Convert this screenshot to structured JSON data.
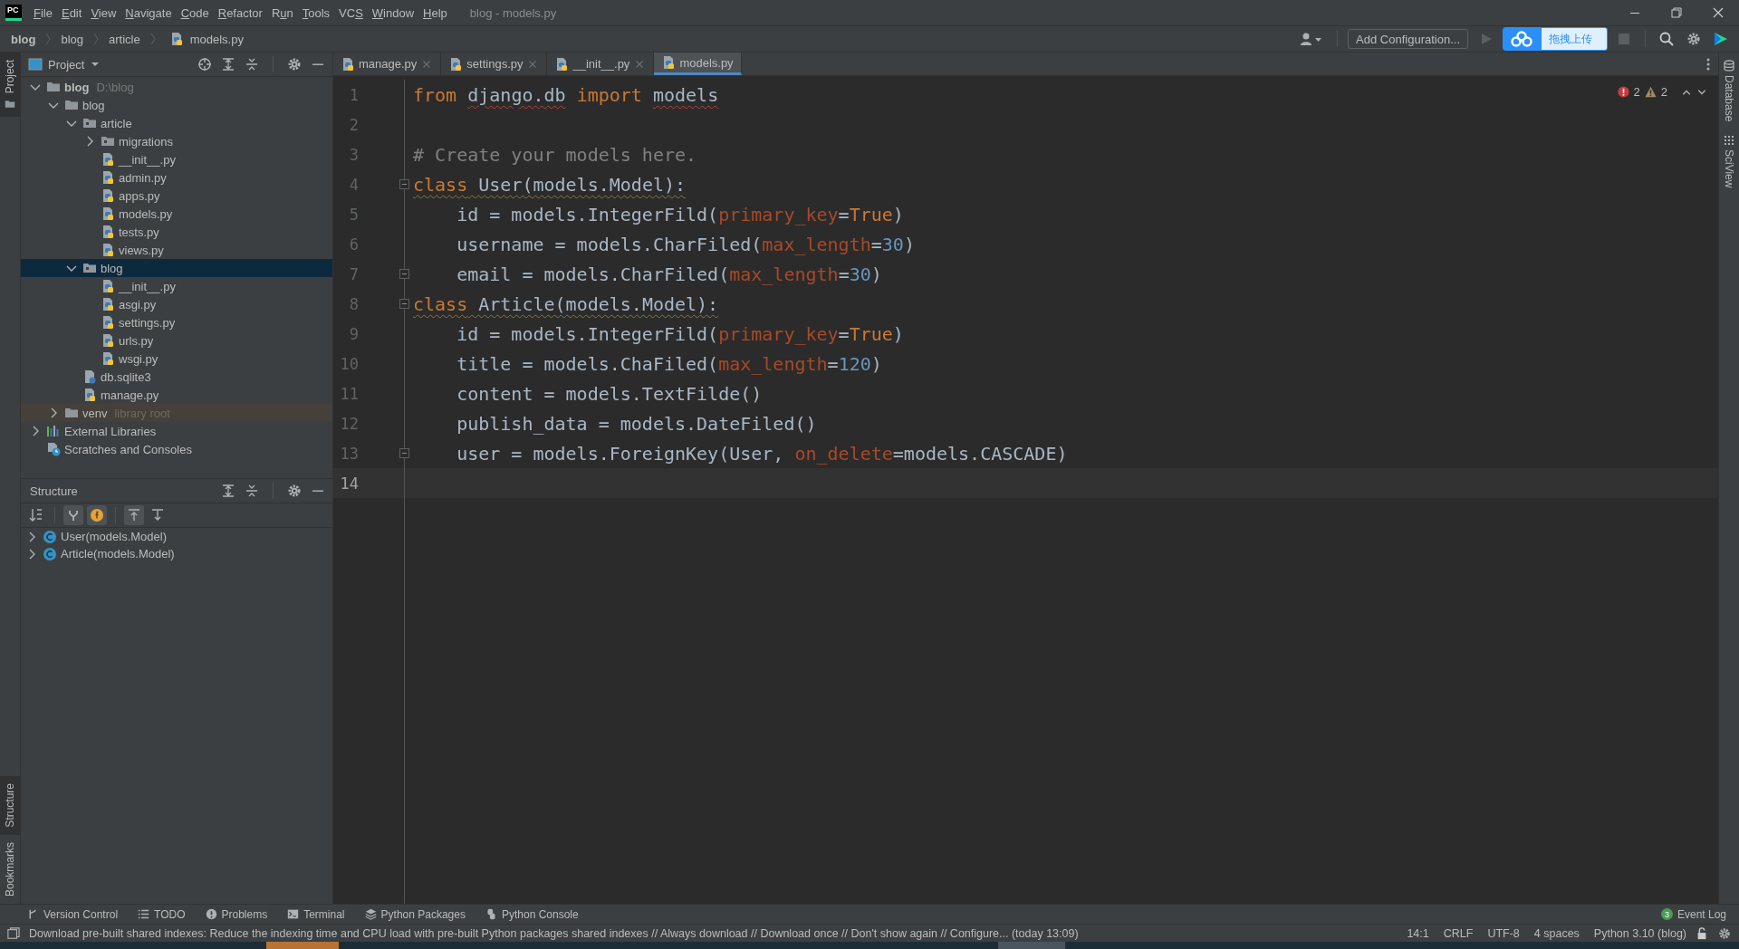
{
  "window": {
    "logo": "PC",
    "title": "blog - models.py",
    "menu": [
      {
        "key": "F",
        "after": "ile"
      },
      {
        "key": "E",
        "after": "dit"
      },
      {
        "key": "V",
        "after": "iew"
      },
      {
        "key": "N",
        "after": "avigate"
      },
      {
        "key": "C",
        "after": "ode"
      },
      {
        "key": "R",
        "after": "efactor"
      },
      {
        "before": "R",
        "key": "u",
        "after": "n"
      },
      {
        "key": "T",
        "after": "ools"
      },
      {
        "before": "VC",
        "key": "S"
      },
      {
        "key": "W",
        "after": "indow"
      },
      {
        "key": "H",
        "after": "elp"
      }
    ]
  },
  "breadcrumb": [
    {
      "label": "blog",
      "kind": "root"
    },
    {
      "label": "blog",
      "kind": "folder"
    },
    {
      "label": "article",
      "kind": "folder"
    },
    {
      "label": "models.py",
      "kind": "py"
    }
  ],
  "toolbar": {
    "run_config": "Add Configuration...",
    "upload_widget": "拖拽上传"
  },
  "left_stripe": {
    "top": [
      {
        "label": "Project",
        "selected": true
      }
    ],
    "bottom": [
      {
        "label": "Structure",
        "selected": true
      },
      {
        "label": "Bookmarks",
        "selected": false
      }
    ]
  },
  "project_panel": {
    "title": "Project",
    "tree": [
      {
        "label": "blog",
        "hint": "D:\\blog",
        "kind": "root",
        "expanded": true,
        "selected": false,
        "children": [
          {
            "label": "blog",
            "kind": "folder",
            "expanded": true,
            "selected": false,
            "children": [
              {
                "label": "article",
                "kind": "package",
                "expanded": true,
                "selected": false,
                "children": [
                  {
                    "label": "migrations",
                    "kind": "package",
                    "expanded": false,
                    "selected": false
                  },
                  {
                    "label": "__init__.py",
                    "kind": "py",
                    "selected": false
                  },
                  {
                    "label": "admin.py",
                    "kind": "py",
                    "selected": false
                  },
                  {
                    "label": "apps.py",
                    "kind": "py",
                    "selected": false
                  },
                  {
                    "label": "models.py",
                    "kind": "py",
                    "selected": false
                  },
                  {
                    "label": "tests.py",
                    "kind": "py",
                    "selected": false
                  },
                  {
                    "label": "views.py",
                    "kind": "py",
                    "selected": false
                  }
                ]
              },
              {
                "label": "blog",
                "kind": "package",
                "expanded": true,
                "selected": true,
                "children": [
                  {
                    "label": "__init__.py",
                    "kind": "py",
                    "selected": false
                  },
                  {
                    "label": "asgi.py",
                    "kind": "py",
                    "selected": false
                  },
                  {
                    "label": "settings.py",
                    "kind": "py",
                    "selected": false
                  },
                  {
                    "label": "urls.py",
                    "kind": "py",
                    "selected": false
                  },
                  {
                    "label": "wsgi.py",
                    "kind": "py",
                    "selected": false
                  }
                ]
              },
              {
                "label": "db.sqlite3",
                "kind": "db",
                "selected": false
              },
              {
                "label": "manage.py",
                "kind": "py",
                "selected": false
              }
            ]
          },
          {
            "label": "venv",
            "hint": "library root",
            "kind": "library-folder",
            "expanded": false,
            "selected": false
          }
        ]
      },
      {
        "label": "External Libraries",
        "kind": "libraries",
        "expanded": false,
        "selected": false
      },
      {
        "label": "Scratches and Consoles",
        "kind": "scratches",
        "selected": false
      }
    ]
  },
  "structure_panel": {
    "title": "Structure",
    "tools": [
      {
        "kind": "sort",
        "on": false
      },
      {
        "kind": "inherited",
        "on": true
      },
      {
        "kind": "fields",
        "on": true
      },
      {
        "kind": "scroll-to",
        "on": true
      },
      {
        "kind": "scroll-from",
        "on": false
      }
    ],
    "items": [
      {
        "label": "User(models.Model)",
        "expanded": false
      },
      {
        "label": "Article(models.Model)",
        "expanded": false
      }
    ]
  },
  "editor": {
    "tabs": [
      {
        "label": "manage.py",
        "selected": false
      },
      {
        "label": "settings.py",
        "selected": false
      },
      {
        "label": "__init__.py",
        "selected": false
      },
      {
        "label": "models.py",
        "selected": true
      }
    ],
    "inspections": {
      "errors": "2",
      "warnings": "2"
    },
    "lines": [
      {
        "number": "1",
        "current": false,
        "fold_marker": false,
        "tokens": [
          {
            "text": "from ",
            "kind": "keyword"
          },
          {
            "text": "django.db",
            "kind": "unresolved"
          },
          {
            "text": " import ",
            "kind": "keyword"
          },
          {
            "text": "models",
            "kind": "unresolved"
          }
        ]
      },
      {
        "number": "2",
        "current": false,
        "fold_marker": false
      },
      {
        "number": "3",
        "current": false,
        "fold_marker": false,
        "tokens": [
          {
            "text": "# Create your models here.",
            "kind": "comment"
          }
        ]
      },
      {
        "number": "4",
        "current": false,
        "fold_marker": true,
        "tokens": [
          {
            "text": "class",
            "kind": "keyword-weak"
          },
          {
            "text": " User(models.Model):",
            "kind": "plain-weak"
          }
        ]
      },
      {
        "number": "5",
        "current": false,
        "fold_marker": false,
        "tokens": [
          {
            "text": "    id = models.IntegerFild(",
            "kind": "plain"
          },
          {
            "text": "primary_key",
            "kind": "param"
          },
          {
            "text": "=",
            "kind": "plain"
          },
          {
            "text": "True",
            "kind": "keyword"
          },
          {
            "text": ")",
            "kind": "plain"
          }
        ]
      },
      {
        "number": "6",
        "current": false,
        "fold_marker": false,
        "tokens": [
          {
            "text": "    username = models.CharFiled(",
            "kind": "plain"
          },
          {
            "text": "max_length",
            "kind": "param"
          },
          {
            "text": "=",
            "kind": "plain"
          },
          {
            "text": "30",
            "kind": "number"
          },
          {
            "text": ")",
            "kind": "plain"
          }
        ]
      },
      {
        "number": "7",
        "current": false,
        "fold_marker": true,
        "tokens": [
          {
            "text": "    email = models.CharFiled(",
            "kind": "plain"
          },
          {
            "text": "max_length",
            "kind": "param"
          },
          {
            "text": "=",
            "kind": "plain"
          },
          {
            "text": "30",
            "kind": "number"
          },
          {
            "text": ")",
            "kind": "plain"
          }
        ]
      },
      {
        "number": "8",
        "current": false,
        "fold_marker": true,
        "tokens": [
          {
            "text": "class",
            "kind": "keyword-weak"
          },
          {
            "text": " Article(models.Model):",
            "kind": "plain-weak"
          }
        ]
      },
      {
        "number": "9",
        "current": false,
        "fold_marker": false,
        "tokens": [
          {
            "text": "    id = models.IntegerFild(",
            "kind": "plain"
          },
          {
            "text": "primary_key",
            "kind": "param"
          },
          {
            "text": "=",
            "kind": "plain"
          },
          {
            "text": "True",
            "kind": "keyword"
          },
          {
            "text": ")",
            "kind": "plain"
          }
        ]
      },
      {
        "number": "10",
        "current": false,
        "fold_marker": false,
        "tokens": [
          {
            "text": "    title = models.ChaFiled(",
            "kind": "plain"
          },
          {
            "text": "max_length",
            "kind": "param"
          },
          {
            "text": "=",
            "kind": "plain"
          },
          {
            "text": "120",
            "kind": "number"
          },
          {
            "text": ")",
            "kind": "plain"
          }
        ]
      },
      {
        "number": "11",
        "current": false,
        "fold_marker": false,
        "tokens": [
          {
            "text": "    content = models.TextFilde()",
            "kind": "plain"
          }
        ]
      },
      {
        "number": "12",
        "current": false,
        "fold_marker": false,
        "tokens": [
          {
            "text": "    publish_data = models.DateFiled()",
            "kind": "plain"
          }
        ]
      },
      {
        "number": "13",
        "current": false,
        "fold_marker": true,
        "tokens": [
          {
            "text": "    user = models.ForeignKey(User, ",
            "kind": "plain"
          },
          {
            "text": "on_delete",
            "kind": "param"
          },
          {
            "text": "=models.CASCADE)",
            "kind": "plain"
          }
        ]
      },
      {
        "number": "14",
        "current": true,
        "fold_marker": false
      }
    ]
  },
  "right_stripe": [
    {
      "label": "Database",
      "kind": "database"
    },
    {
      "label": "SciView",
      "kind": "sciview"
    }
  ],
  "tool_windows": [
    {
      "label": "Version Control",
      "kind": "vcs"
    },
    {
      "label": "TODO",
      "kind": "todo"
    },
    {
      "label": "Problems",
      "kind": "problems"
    },
    {
      "label": "Terminal",
      "kind": "terminal"
    },
    {
      "label": "Python Packages",
      "kind": "packages"
    },
    {
      "label": "Python Console",
      "kind": "console"
    }
  ],
  "event_log": {
    "label": "Event Log",
    "count": "3"
  },
  "status_bar": {
    "message": "Download pre-built shared indexes: Reduce the indexing time and CPU load with pre-built Python packages shared indexes // Always download // Download once // Don't show again // Configure... (today 13:09)",
    "items": [
      "14:1",
      "CRLF",
      "UTF-8",
      "4 spaces",
      "Python 3.10 (blog)"
    ]
  }
}
